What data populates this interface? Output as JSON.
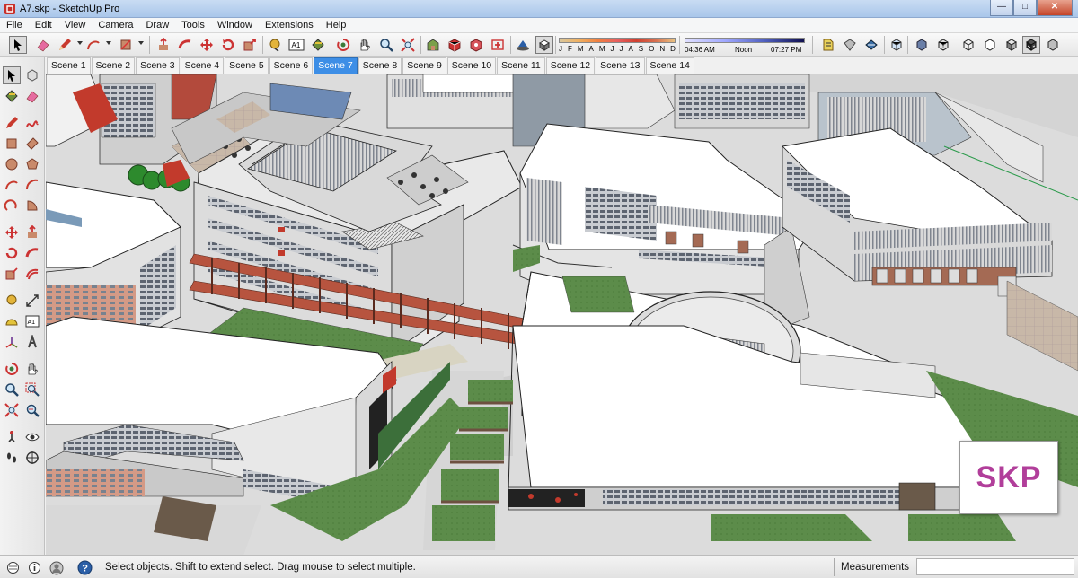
{
  "window": {
    "title": "A7.skp - SketchUp Pro"
  },
  "menu": {
    "items": [
      "File",
      "Edit",
      "View",
      "Camera",
      "Draw",
      "Tools",
      "Window",
      "Extensions",
      "Help"
    ]
  },
  "shadow": {
    "months": [
      "J",
      "F",
      "M",
      "A",
      "M",
      "J",
      "J",
      "A",
      "S",
      "O",
      "N",
      "D"
    ],
    "time_start": "04:36 AM",
    "time_mid": "Noon",
    "time_end": "07:27 PM"
  },
  "scenes": {
    "tabs": [
      "Scene 1",
      "Scene 2",
      "Scene 3",
      "Scene 4",
      "Scene 5",
      "Scene 6",
      "Scene 7",
      "Scene 8",
      "Scene 9",
      "Scene 10",
      "Scene 11",
      "Scene 12",
      "Scene 13",
      "Scene 14"
    ],
    "active_index": 6
  },
  "watermark": {
    "text": "SKP"
  },
  "status": {
    "message": "Select objects. Shift to extend select. Drag mouse to select multiple.",
    "measurements_label": "Measurements",
    "measurements_value": ""
  },
  "colors": {
    "active_tab": "#3d8ee6",
    "logo": "#b13e9a",
    "grass": "#5c8c4a",
    "roof": "#ffffff"
  }
}
